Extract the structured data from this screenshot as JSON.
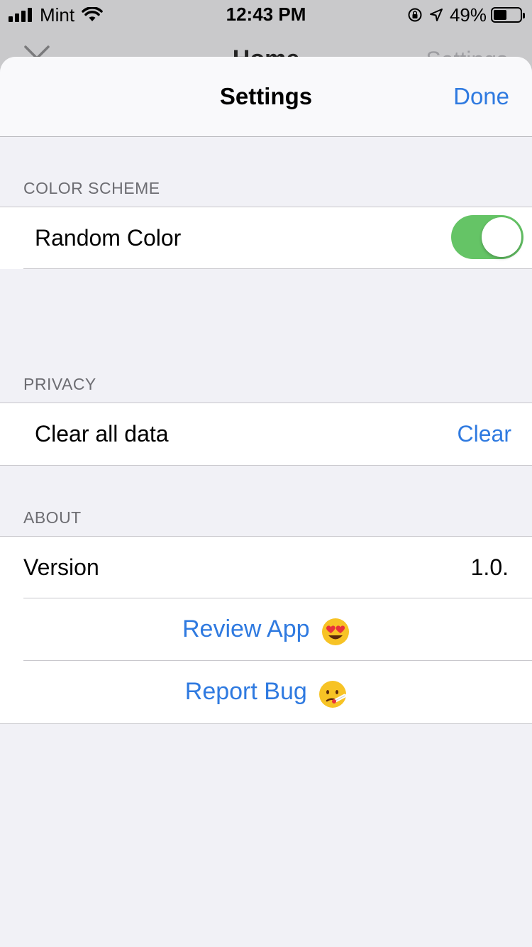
{
  "status_bar": {
    "carrier": "Mint",
    "time": "12:43 PM",
    "battery_percent": "49%",
    "battery_level": 0.49,
    "icons": [
      "signal-icon",
      "wifi-icon",
      "orientation-lock-icon",
      "location-arrow-icon",
      "battery-icon"
    ]
  },
  "background_nav": {
    "title": "Home",
    "right_label": "Settings",
    "left_icon": "close-icon"
  },
  "sheet": {
    "title": "Settings",
    "done_label": "Done"
  },
  "sections": {
    "color_scheme": {
      "header": "COLOR SCHEME",
      "random_color_label": "Random Color",
      "random_color_on": true
    },
    "privacy": {
      "header": "PRIVACY",
      "clear_data_label": "Clear all data",
      "clear_button_label": "Clear"
    },
    "about": {
      "header": "ABOUT",
      "version_label": "Version",
      "version_value": "1.0.",
      "review_label": "Review App",
      "review_emoji": "smiling-face-with-heart-eyes-icon",
      "report_label": "Report Bug",
      "report_emoji": "face-with-thermometer-icon"
    }
  },
  "colors": {
    "accent": "#2f7ae0",
    "toggle_on": "#65c466",
    "grouped_background": "#f1f1f6"
  }
}
